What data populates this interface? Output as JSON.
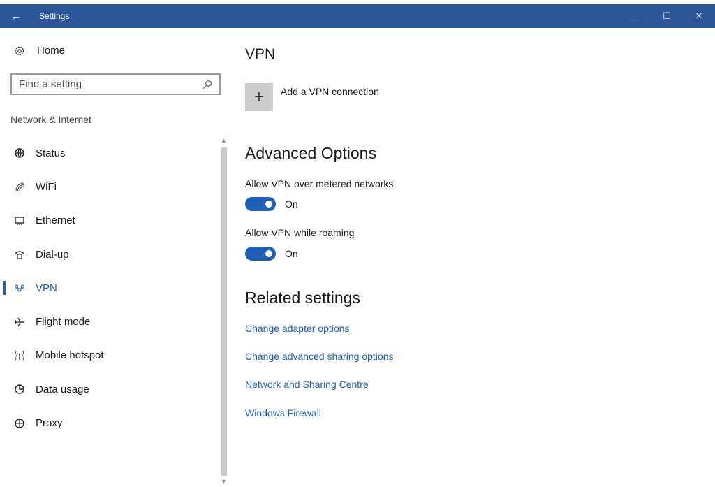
{
  "window": {
    "title": "Settings",
    "back_glyph": "←",
    "minimize_glyph": "—",
    "maximize_glyph": "☐",
    "close_glyph": "✕",
    "accent_color": "#2b579a"
  },
  "sidebar": {
    "home_label": "Home",
    "home_icon": "gear-icon",
    "search_placeholder": "Find a setting",
    "section_label": "Network & Internet",
    "items": [
      {
        "label": "Status",
        "icon": "globe-status-icon",
        "active": false
      },
      {
        "label": "WiFi",
        "icon": "wifi-icon",
        "active": false
      },
      {
        "label": "Ethernet",
        "icon": "ethernet-icon",
        "active": false
      },
      {
        "label": "Dial-up",
        "icon": "dialup-icon",
        "active": false
      },
      {
        "label": "VPN",
        "icon": "vpn-icon",
        "active": true
      },
      {
        "label": "Flight mode",
        "icon": "airplane-icon",
        "active": false
      },
      {
        "label": "Mobile hotspot",
        "icon": "hotspot-icon",
        "active": false
      },
      {
        "label": "Data usage",
        "icon": "pie-chart-icon",
        "active": false
      },
      {
        "label": "Proxy",
        "icon": "globe-icon",
        "active": false
      }
    ]
  },
  "main": {
    "vpn_heading": "VPN",
    "add_vpn_label": "Add a VPN connection",
    "add_vpn_glyph": "+",
    "advanced_heading": "Advanced Options",
    "options": [
      {
        "label": "Allow VPN over metered networks",
        "state": "On"
      },
      {
        "label": "Allow VPN while roaming",
        "state": "On"
      }
    ],
    "related_heading": "Related settings",
    "links": [
      "Change adapter options",
      "Change advanced sharing options",
      "Network and Sharing Centre",
      "Windows Firewall"
    ],
    "link_color": "#1f5fb4"
  }
}
